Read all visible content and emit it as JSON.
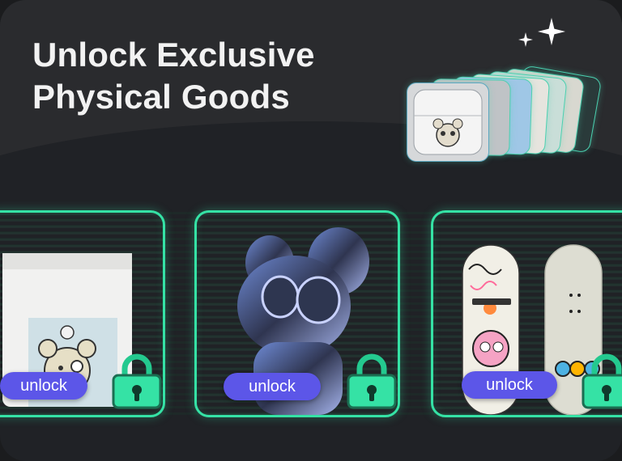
{
  "header": {
    "title_line1": "Unlock Exclusive",
    "title_line2": "Physical Goods"
  },
  "products": [
    {
      "name": "t-shirt",
      "action_label": "unlock",
      "locked": true
    },
    {
      "name": "chrome-figure",
      "action_label": "unlock",
      "locked": true
    },
    {
      "name": "skateboards",
      "action_label": "unlock",
      "locked": true
    }
  ],
  "colors": {
    "accent_green": "#35e2a5",
    "button_purple": "#5c56e8",
    "background": "#202226"
  },
  "icons": [
    "sparkle-icon",
    "lock-icon"
  ]
}
